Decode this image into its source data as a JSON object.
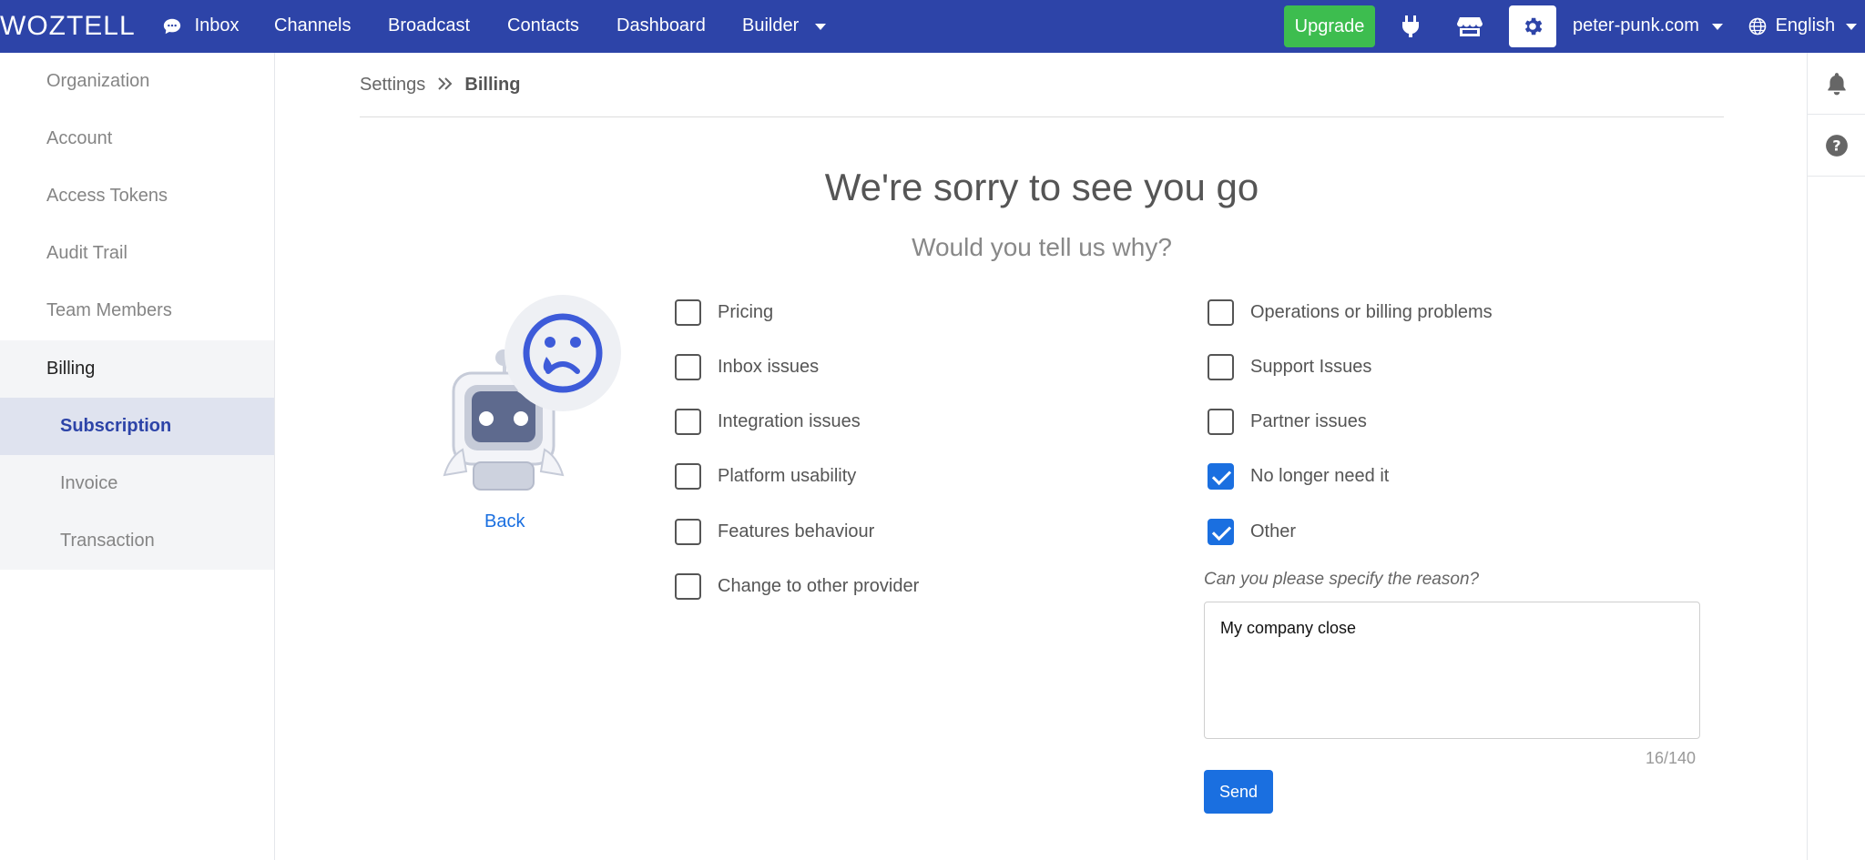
{
  "nav": {
    "logo": "WOZTELL",
    "items": [
      {
        "label": "Inbox"
      },
      {
        "label": "Channels"
      },
      {
        "label": "Broadcast"
      },
      {
        "label": "Contacts"
      },
      {
        "label": "Dashboard"
      },
      {
        "label": "Builder"
      }
    ],
    "upgrade_label": "Upgrade",
    "account": "peter-punk.com",
    "language": "English"
  },
  "sidebar": {
    "items": [
      {
        "label": "Organization"
      },
      {
        "label": "Account"
      },
      {
        "label": "Access Tokens"
      },
      {
        "label": "Audit Trail"
      },
      {
        "label": "Team Members"
      },
      {
        "label": "Billing"
      },
      {
        "label": "Subscription"
      },
      {
        "label": "Invoice"
      },
      {
        "label": "Transaction"
      }
    ],
    "active": "Subscription"
  },
  "breadcrumb": {
    "root": "Settings",
    "current": "Billing"
  },
  "main": {
    "title": "We're sorry to see you go",
    "subtitle": "Would you tell us why?",
    "back_label": "Back",
    "left_options": [
      {
        "label": "Pricing",
        "checked": false
      },
      {
        "label": "Inbox issues",
        "checked": false
      },
      {
        "label": "Integration issues",
        "checked": false
      },
      {
        "label": "Platform usability",
        "checked": false
      },
      {
        "label": "Features behaviour",
        "checked": false
      },
      {
        "label": "Change to other provider",
        "checked": false
      }
    ],
    "right_options": [
      {
        "label": "Operations or billing problems",
        "checked": false
      },
      {
        "label": "Support Issues",
        "checked": false
      },
      {
        "label": "Partner issues",
        "checked": false
      },
      {
        "label": "No longer need it",
        "checked": true
      },
      {
        "label": "Other",
        "checked": true
      }
    ],
    "reason_label": "Can you please specify the reason?",
    "reason_value": "My company close",
    "counter": "16/140",
    "send_label": "Send"
  },
  "colors": {
    "nav_bg": "#2d44a8",
    "upgrade": "#3dbd4f",
    "primary": "#1a6fe0"
  }
}
